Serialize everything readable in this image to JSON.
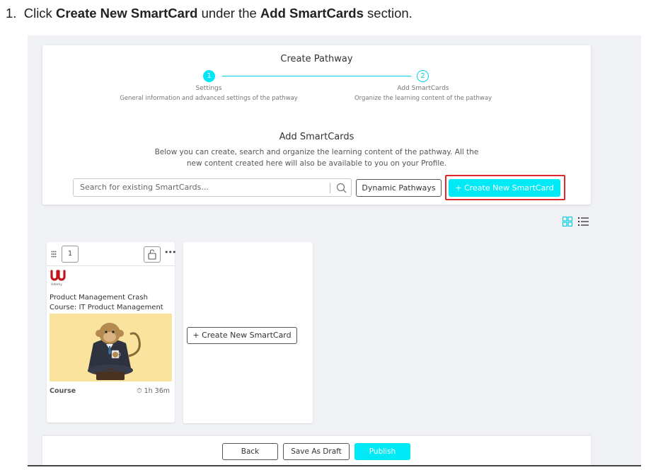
{
  "instruction": {
    "number": "1.",
    "prefix": "Click",
    "target": "Create New SmartCard",
    "middle": "under the",
    "section": "Add SmartCards",
    "suffix": "section."
  },
  "panel": {
    "title": "Create Pathway",
    "steps": [
      {
        "number": "1",
        "name": "Settings",
        "description": "General information and advanced settings of the pathway",
        "state": "completed"
      },
      {
        "number": "2",
        "name": "Add SmartCards",
        "description": "Organize the learning content of the pathway",
        "state": "current"
      }
    ],
    "section_title": "Add SmartCards",
    "section_description": "Below you can create, search and organize the learning content of the pathway. All the new content created here will also be available to you on your Profile.",
    "search_placeholder": "Search for existing SmartCards...",
    "dynamic_button": "Dynamic Pathways",
    "create_button": "+ Create New SmartCard"
  },
  "view_icons": [
    "grid-view-icon",
    "list-view-icon"
  ],
  "cards": [
    {
      "order": "1",
      "provider": "Udemy",
      "title": "Product Management Crash Course: IT Product Management",
      "type": "Course",
      "duration": "⏱ 1h 36m",
      "icons": [
        "drag-handle-icon",
        "unlock-icon",
        "more-icon"
      ]
    }
  ],
  "new_card": {
    "button": "+ Create New SmartCard"
  },
  "footer": {
    "back": "Back",
    "save_draft": "Save As Draft",
    "publish": "Publish"
  },
  "colors": {
    "accent": "#00e9f6",
    "highlight": "#e0262c",
    "background": "#f0f1f4",
    "thumb": "#f9e39d"
  }
}
